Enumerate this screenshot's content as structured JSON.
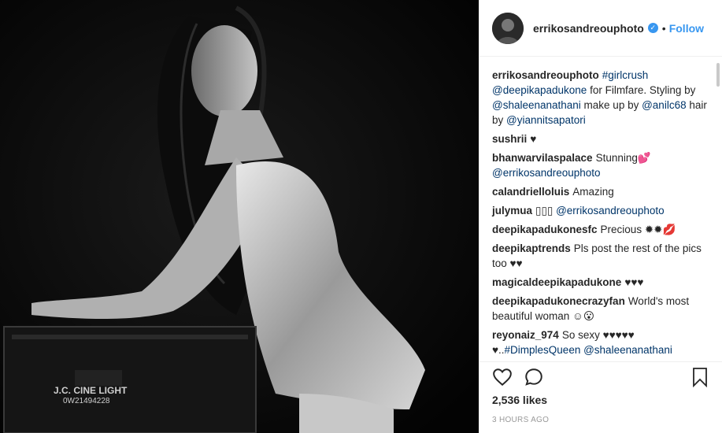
{
  "post": {
    "username": "errikosandreouphoto",
    "verified_glyph": "✓",
    "separator": "•",
    "follow_label": "Follow",
    "likes": "2,536 likes",
    "time": "3 HOURS AGO"
  },
  "caption": {
    "username": "errikosandreouphoto",
    "hashtag": "#girlcrush",
    "mention1": "@deepikapadukone",
    "text1": " for Filmfare. Styling by ",
    "mention2": "@shaleenanathani",
    "text2": " make up by ",
    "mention3": "@anilc68",
    "text3": " hair by ",
    "mention4": "@yiannitsapatori"
  },
  "comments": [
    {
      "user": "sushrii",
      "text": "♥",
      "mention": "",
      "tail": ""
    },
    {
      "user": "bhanwarvilaspalace",
      "text": "Stunning💕",
      "mention": "@errikosandreouphoto",
      "tail": ""
    },
    {
      "user": "calandrielloluis",
      "text": "Amazing",
      "mention": "",
      "tail": ""
    },
    {
      "user": "julymua",
      "text": "▯▯▯ ",
      "mention": "@errikosandreouphoto",
      "tail": ""
    },
    {
      "user": "deepikapadukonesfc",
      "text": "Precious ✹✹💋",
      "mention": "",
      "tail": ""
    },
    {
      "user": "deepikaptrends",
      "text": "Pls post the rest of the pics too ♥♥",
      "mention": "",
      "tail": ""
    },
    {
      "user": "magicaldeepikapadukone",
      "text": "♥♥♥",
      "mention": "",
      "tail": ""
    },
    {
      "user": "deepikapadukonecrazyfan",
      "text": "World's most beautiful woman ☺😮",
      "mention": "",
      "tail": ""
    },
    {
      "user": "reyonaiz_974",
      "text": "So sexy ♥♥♥♥♥ ♥..",
      "mention": "#DimplesQueen",
      "tail": " @shaleenanathani"
    }
  ],
  "photo": {
    "box_text_line1": "J.C. CINE LIGHT",
    "box_text_line2": "0W21494228"
  },
  "icons": [
    "heart-icon",
    "comment-icon",
    "bookmark-icon",
    "verified-badge-icon"
  ]
}
